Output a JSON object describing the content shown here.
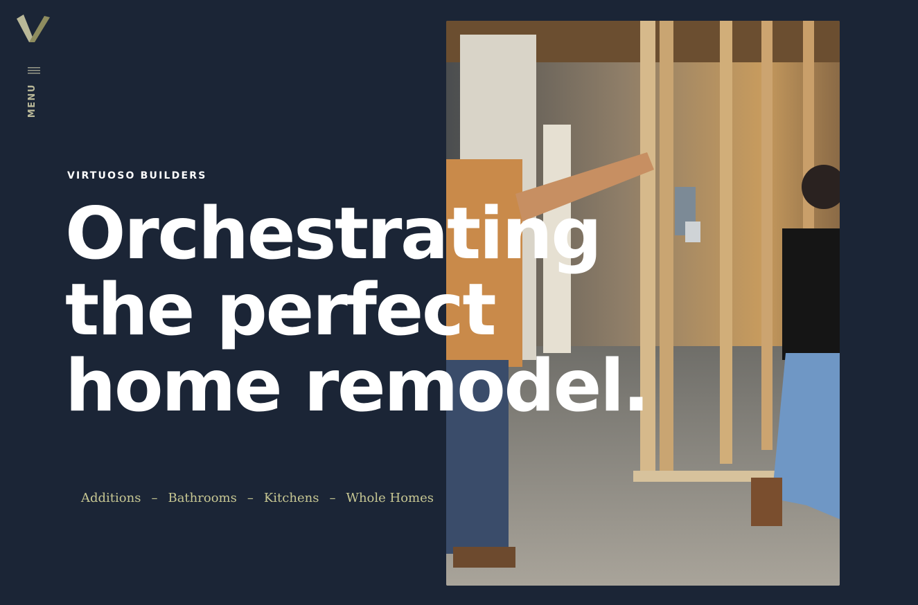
{
  "brand": {
    "logo_icon": "v-logo-icon",
    "name": "VIRTUOSO BUILDERS",
    "colors": {
      "background": "#1b2536",
      "accent": "#c7c793",
      "logo_light": "#b9b898",
      "logo_dark": "#8e8c5f"
    }
  },
  "nav": {
    "menu_icon": "hamburger-icon",
    "menu_label": "MENU"
  },
  "hero": {
    "headline_lines": [
      "Orchestrating",
      "the perfect",
      "home remodel."
    ],
    "image_alt": "Contractor and homeowner walking through a framed remodel site"
  },
  "services": {
    "items": [
      "Additions",
      "Bathrooms",
      "Kitchens",
      "Whole Homes"
    ],
    "separator": "–"
  }
}
